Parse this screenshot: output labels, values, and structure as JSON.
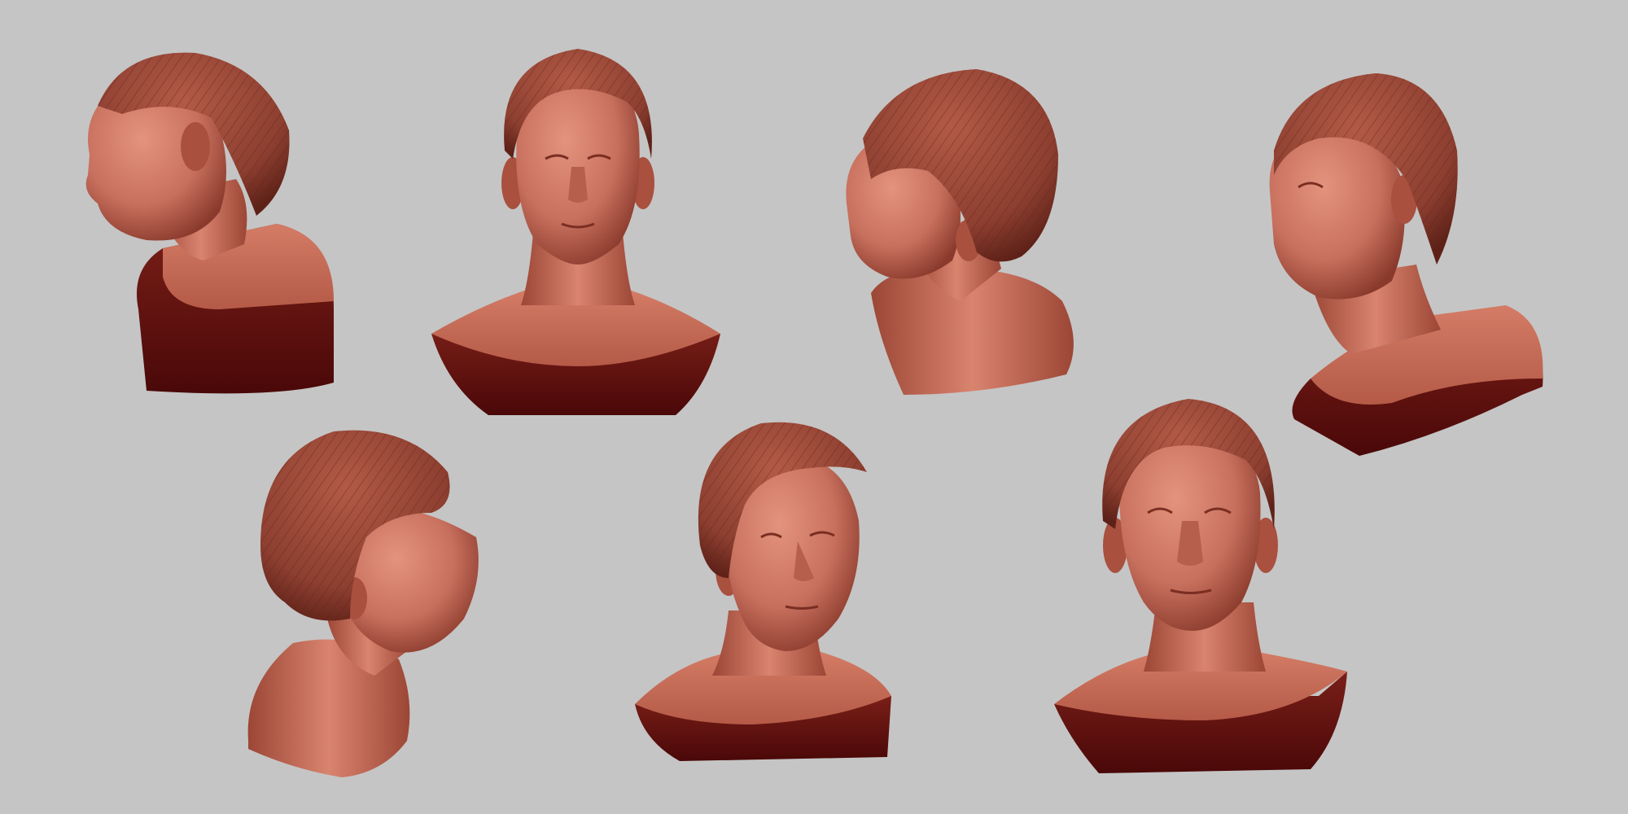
{
  "scene": {
    "background_color": "#c5c5c5",
    "palette": {
      "skin": "#c8705e",
      "skin_light": "#e0907c",
      "skin_shadow": "#8a3a2c",
      "hair": "#9a4a3a",
      "hair_dark": "#5e2118",
      "base_top": "#c86a56",
      "base_side": "#5a1010"
    },
    "busts": [
      {
        "view": "left-profile",
        "label": "bust-left-profile"
      },
      {
        "view": "front-up",
        "label": "bust-front-up"
      },
      {
        "view": "back-three-quarter-left",
        "label": "bust-back-three-quarter-left"
      },
      {
        "view": "three-quarter-left-up",
        "label": "bust-three-quarter-left-up"
      },
      {
        "view": "back-three-quarter-right",
        "label": "bust-back-three-quarter-right"
      },
      {
        "view": "three-quarter-right",
        "label": "bust-three-quarter-right"
      },
      {
        "view": "front",
        "label": "bust-front"
      }
    ]
  }
}
